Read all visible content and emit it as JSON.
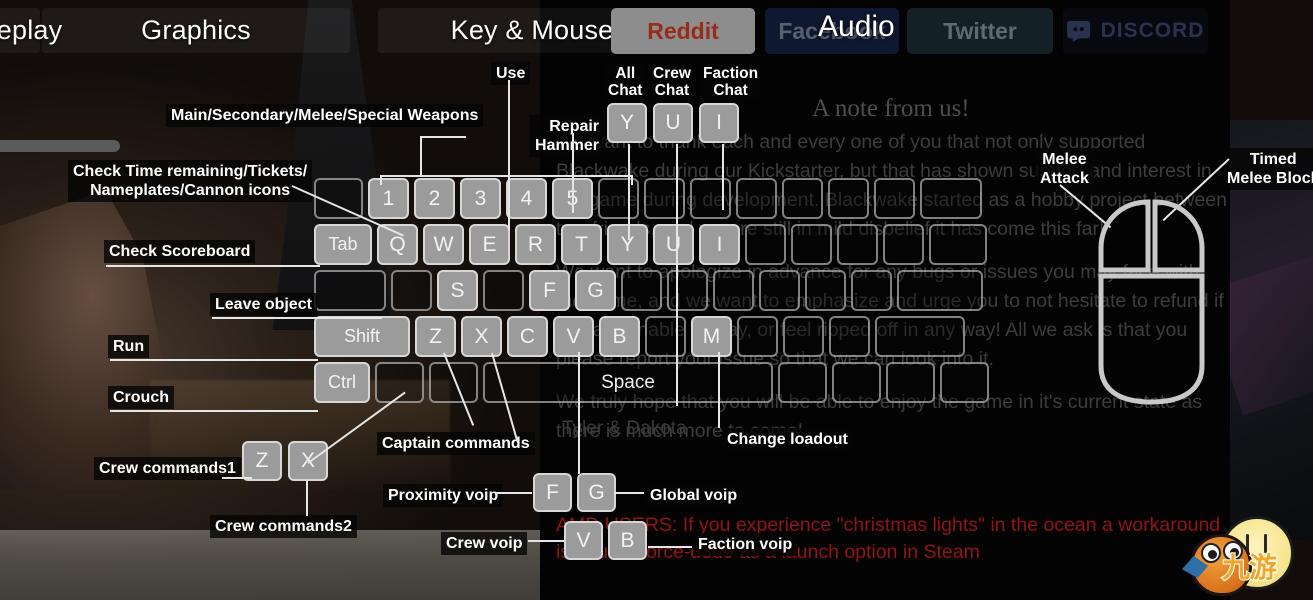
{
  "menu": {
    "tabs": [
      {
        "label": "Gameplay",
        "partial": true
      },
      {
        "label": "Graphics"
      },
      {
        "label": "Key & Mouse"
      },
      {
        "label": "Audio"
      }
    ],
    "slider_label": "y"
  },
  "social": {
    "reddit": "Reddit",
    "facebook": "Facebook",
    "twitter": "Twitter",
    "discord": "DISCORD"
  },
  "note": {
    "title": "A note from us!",
    "paragraphs": [
      "We want to thank each and every one of you that not only supported Blackwake during our Kickstarter, but that has shown support and interest in the game during development. Blackwake started as a hobby project between two friends, and we are still in mild disbelief it has come this far!",
      "We want to apologize in advance for any bugs or issues you may face with the game, and we want to emphasize and urge you to not hesitate to refund if you are unable to play, or feel ripped off in any way! All we ask is that you please report your issue so that we can look into it.",
      "We truly hope that you will be able to enjoy the game in it's current state as there is much more to come!"
    ],
    "signature": "Tyler & Dakota",
    "warning": "AMD USERS: If you experience \"christmas lights\" in the ocean a workaround is to use -force-d3d9 as a launch option in Steam"
  },
  "chat_keys": [
    {
      "key": "Y",
      "caption_line1": "All",
      "caption_line2": "Chat"
    },
    {
      "key": "U",
      "caption_line1": "Crew",
      "caption_line2": "Chat"
    },
    {
      "key": "I",
      "caption_line1": "Faction",
      "caption_line2": "Chat"
    }
  ],
  "keyboard": {
    "rows": [
      [
        {
          "label": "",
          "lit": false,
          "w": "w-mod"
        },
        {
          "label": "1",
          "lit": true
        },
        {
          "label": "2",
          "lit": true
        },
        {
          "label": "3",
          "lit": true
        },
        {
          "label": "4",
          "lit": true
        },
        {
          "label": "5",
          "lit": true
        },
        {
          "label": "",
          "lit": false
        },
        {
          "label": "",
          "lit": false
        },
        {
          "label": "",
          "lit": false
        },
        {
          "label": "",
          "lit": false
        },
        {
          "label": "",
          "lit": false
        },
        {
          "label": "",
          "lit": false
        },
        {
          "label": "",
          "lit": false
        },
        {
          "label": "",
          "lit": false,
          "w": "w-back"
        }
      ],
      [
        {
          "label": "Tab",
          "lit": true,
          "w": "w-tab"
        },
        {
          "label": "Q",
          "lit": true
        },
        {
          "label": "W",
          "lit": true
        },
        {
          "label": "E",
          "lit": true
        },
        {
          "label": "R",
          "lit": true
        },
        {
          "label": "T",
          "lit": true
        },
        {
          "label": "Y",
          "lit": true
        },
        {
          "label": "U",
          "lit": true
        },
        {
          "label": "I",
          "lit": true
        },
        {
          "label": "",
          "lit": false
        },
        {
          "label": "",
          "lit": false
        },
        {
          "label": "",
          "lit": false
        },
        {
          "label": "",
          "lit": false
        },
        {
          "label": "",
          "lit": false,
          "w": "w-tab"
        }
      ],
      [
        {
          "label": "",
          "lit": false,
          "w": "w-caps"
        },
        {
          "label": "",
          "lit": false
        },
        {
          "label": "S",
          "lit": true
        },
        {
          "label": "",
          "lit": false
        },
        {
          "label": "F",
          "lit": true
        },
        {
          "label": "G",
          "lit": true
        },
        {
          "label": "",
          "lit": false
        },
        {
          "label": "",
          "lit": false
        },
        {
          "label": "",
          "lit": false
        },
        {
          "label": "",
          "lit": false
        },
        {
          "label": "",
          "lit": false
        },
        {
          "label": "",
          "lit": false
        },
        {
          "label": "",
          "lit": false,
          "w": "w-enter"
        }
      ],
      [
        {
          "label": "Shift",
          "lit": true,
          "w": "w-shift"
        },
        {
          "label": "Z",
          "lit": true
        },
        {
          "label": "X",
          "lit": true
        },
        {
          "label": "C",
          "lit": true
        },
        {
          "label": "V",
          "lit": true
        },
        {
          "label": "B",
          "lit": true
        },
        {
          "label": "",
          "lit": false
        },
        {
          "label": "M",
          "lit": true
        },
        {
          "label": "",
          "lit": false
        },
        {
          "label": "",
          "lit": false
        },
        {
          "label": "",
          "lit": false
        },
        {
          "label": "",
          "lit": false,
          "w": "w-rshift"
        }
      ],
      [
        {
          "label": "Ctrl",
          "lit": true,
          "w": "w-ctrl"
        },
        {
          "label": "",
          "lit": false,
          "w": "w-mod"
        },
        {
          "label": "",
          "lit": false,
          "w": "w-mod"
        },
        {
          "label": "Space",
          "lit": false,
          "w": "w-space"
        },
        {
          "label": "",
          "lit": false,
          "w": "w-mod"
        },
        {
          "label": "",
          "lit": false,
          "w": "w-mod"
        },
        {
          "label": "",
          "lit": false,
          "w": "w-mod"
        },
        {
          "label": "",
          "lit": false,
          "w": "w-mod"
        }
      ]
    ]
  },
  "extra_keys": {
    "crew_cmds": [
      {
        "key": "Z"
      },
      {
        "key": "X"
      }
    ],
    "voip_top": [
      {
        "key": "F"
      },
      {
        "key": "G"
      }
    ],
    "voip_bottom": [
      {
        "key": "V"
      },
      {
        "key": "B"
      }
    ]
  },
  "callouts": {
    "weapons": "Main/Secondary/Melee/Special Weapons",
    "use": "Use",
    "repair_hammer_l1": "Repair",
    "repair_hammer_l2": "Hammer",
    "check_time_l1": "Check Time remaining/Tickets/",
    "check_time_l2": "Nameplates/Cannon icons",
    "scoreboard": "Check Scoreboard",
    "leave_object": "Leave object",
    "run": "Run",
    "crouch": "Crouch",
    "crew_commands1": "Crew commands1",
    "crew_commands2": "Crew commands2",
    "captain_commands": "Captain commands",
    "change_loadout": "Change loadout",
    "proximity_voip": "Proximity voip",
    "global_voip": "Global voip",
    "crew_voip": "Crew voip",
    "faction_voip": "Faction voip",
    "melee_attack_l1": "Melee",
    "melee_attack_l2": "Attack",
    "timed_block_l1": "Timed",
    "timed_block_l2": "Melee Block"
  },
  "watermark": {
    "text": "九游"
  },
  "colors": {
    "key_lit": "#9b9b9b",
    "accent_warning": "#8e1616",
    "reddit": "#992b1a",
    "panel": "#030303"
  }
}
